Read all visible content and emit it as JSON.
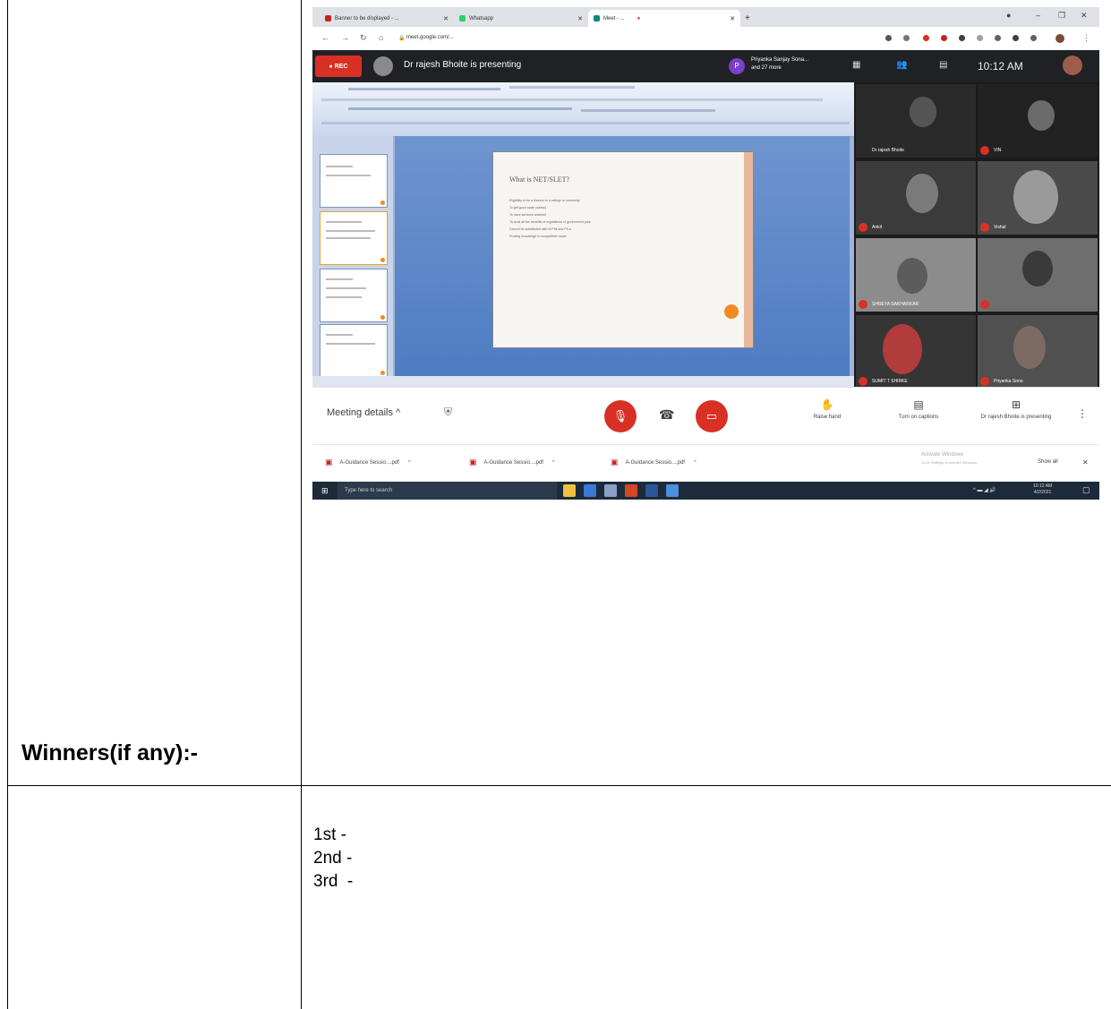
{
  "table": {
    "winners_label": "Winners(if any):-",
    "places": [
      "1st -",
      "2nd -",
      "3rd  -"
    ]
  },
  "screenshot": {
    "browser": {
      "tabs": [
        {
          "label": "Banner to be displayed - ..."
        },
        {
          "label": "Whatsapp"
        },
        {
          "label": "Meet - ..."
        }
      ],
      "url": "meet.google.com/...",
      "window_controls": [
        "–",
        "❐",
        "✕"
      ]
    },
    "meet": {
      "rec_label": "● REC",
      "presenter_text": "Dr rajesh Bhoite is presenting",
      "participants_initial": "P",
      "participants_name": "Priyanka Sanjay Sona...",
      "participants_more": "and 27 more",
      "clock": "10:12 AM"
    },
    "slide": {
      "title": "What is NET/SLET?",
      "bullets": [
        "Eligibility to be a lecturer in a college or university",
        "To get good scale (salary)",
        "To have services retained",
        "To avail all the benefits of regulations of government jobs",
        "Cannot be substituted with M.Phil and Ph.d",
        "Proving knowledge to competitive mode"
      ]
    },
    "tiles": [
      {
        "name": "Dr rajesh Bhoite"
      },
      {
        "name": "VIN"
      },
      {
        "name": "Ankit"
      },
      {
        "name": "Vishal"
      },
      {
        "name": "SHREYA SAKHARKAR"
      },
      {
        "name": ""
      },
      {
        "name": "SUMIT T SHIRKE"
      },
      {
        "name": "Priyanka Sona"
      }
    ],
    "controls": {
      "meeting_details": "Meeting details  ^",
      "raise_hand": "Raise hand",
      "captions": "Turn on captions",
      "presenting": "Dr rajesh Bhoite is presenting"
    },
    "downloads": {
      "items": [
        "A-Guidance Sessio....pdf",
        "A-Guidance Sessio....pdf",
        "A-Guidance Sessio....pdf"
      ],
      "activate_title": "Activate Windows",
      "activate_sub": "Go to Settings to activate Windows.",
      "show_all": "Show all"
    },
    "taskbar": {
      "search_placeholder": "Type here to search",
      "time": "10:12 AM",
      "date": "4/2/2021"
    }
  }
}
